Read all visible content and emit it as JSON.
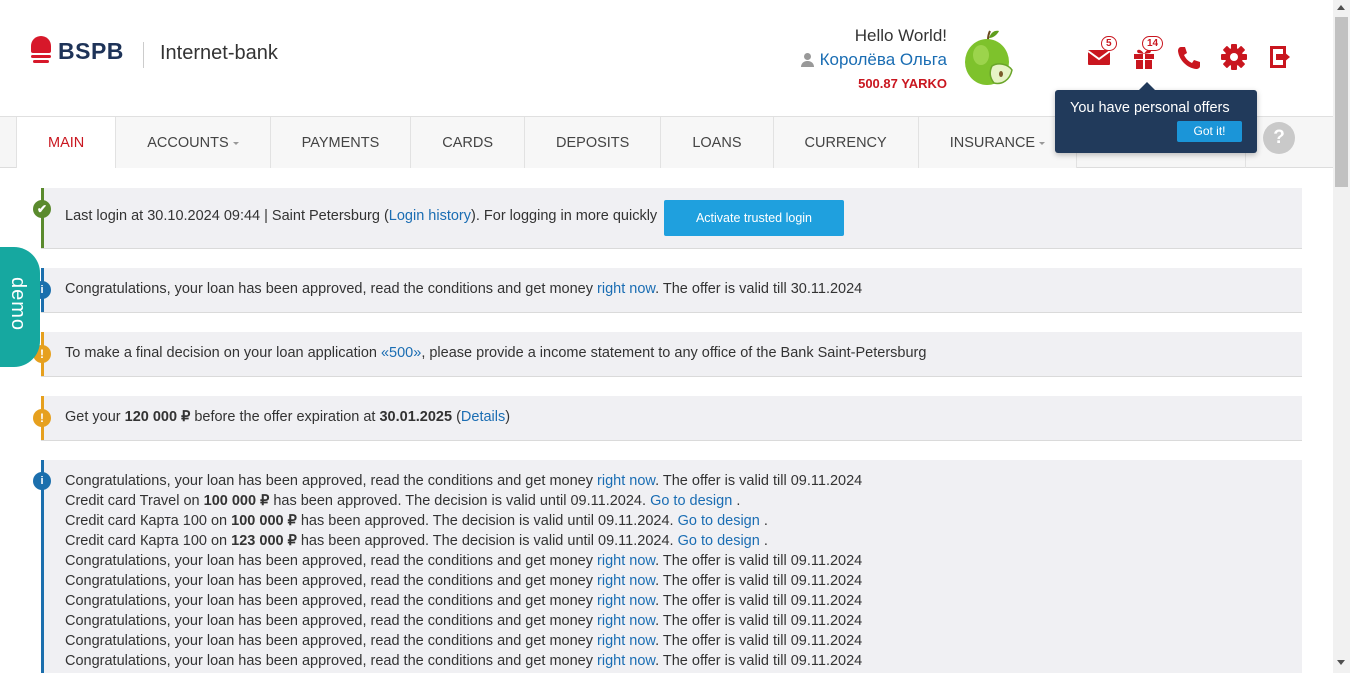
{
  "brand": {
    "logo_text": "BSPB",
    "bank_name": "Internet-bank"
  },
  "user": {
    "greeting": "Hello World!",
    "name": "Королёва Ольга",
    "bonus": "500.87 YARKO"
  },
  "header_icons": [
    {
      "icon": "mail-icon",
      "badge": "5"
    },
    {
      "icon": "gift-icon",
      "badge": "14"
    },
    {
      "icon": "phone-icon"
    },
    {
      "icon": "settings-icon"
    },
    {
      "icon": "logout-icon"
    }
  ],
  "nav": {
    "items": [
      {
        "label": "MAIN",
        "active": true
      },
      {
        "label": "ACCOUNTS",
        "dropdown": true
      },
      {
        "label": "PAYMENTS"
      },
      {
        "label": "CARDS"
      },
      {
        "label": "DEPOSITS"
      },
      {
        "label": "LOANS"
      },
      {
        "label": "CURRENCY"
      },
      {
        "label": "INSURANCE",
        "dropdown": true
      }
    ],
    "help": "?"
  },
  "tooltip": {
    "text": "You have personal offers",
    "button": "Got it!"
  },
  "demo_tab": "demo",
  "notices": {
    "login": {
      "prefix": "Last login at 30.10.2024 09:44 | Saint Petersburg (",
      "link": "Login history",
      "suffix": "). For logging in more quickly",
      "button": "Activate trusted login"
    },
    "loan_approved": {
      "prefix": "Congratulations, your loan has been approved, read the conditions and get money ",
      "link": "right now",
      "suffix": ". The offer is valid till 30.11.2024"
    },
    "income_statement": {
      "prefix": "To make a final decision on your loan application ",
      "link": "«500»",
      "suffix": ", please provide a income statement to any office of the Bank Saint-Petersburg"
    },
    "offer": {
      "prefix": "Get your ",
      "amount": "120 000 ₽",
      "middle": " before the offer expiration at ",
      "date": "30.01.2025",
      "open": " (",
      "link": "Details",
      "close": ")"
    },
    "list": [
      {
        "type": "loan",
        "prefix": "Congratulations, your loan has been approved, read the conditions and get money ",
        "link": "right now",
        "suffix": ". The offer is valid till 09.11.2024"
      },
      {
        "type": "card",
        "prefix": "Credit card Travel on ",
        "amount": "100 000 ₽",
        "middle": " has been approved. The decision is valid until 09.11.2024. ",
        "link": "Go to design",
        "suffix": " ."
      },
      {
        "type": "card",
        "prefix": "Credit card Карта 100 on ",
        "amount": "100 000 ₽",
        "middle": " has been approved. The decision is valid until 09.11.2024. ",
        "link": "Go to design",
        "suffix": " ."
      },
      {
        "type": "card",
        "prefix": "Credit card Карта 100 on ",
        "amount": "123 000 ₽",
        "middle": " has been approved. The decision is valid until 09.11.2024. ",
        "link": "Go to design",
        "suffix": " ."
      },
      {
        "type": "loan",
        "prefix": "Congratulations, your loan has been approved, read the conditions and get money ",
        "link": "right now",
        "suffix": ". The offer is valid till 09.11.2024"
      },
      {
        "type": "loan",
        "prefix": "Congratulations, your loan has been approved, read the conditions and get money ",
        "link": "right now",
        "suffix": ". The offer is valid till 09.11.2024"
      },
      {
        "type": "loan",
        "prefix": "Congratulations, your loan has been approved, read the conditions and get money ",
        "link": "right now",
        "suffix": ". The offer is valid till 09.11.2024"
      },
      {
        "type": "loan",
        "prefix": "Congratulations, your loan has been approved, read the conditions and get money ",
        "link": "right now",
        "suffix": ". The offer is valid till 09.11.2024"
      },
      {
        "type": "loan",
        "prefix": "Congratulations, your loan has been approved, read the conditions and get money ",
        "link": "right now",
        "suffix": ". The offer is valid till 09.11.2024"
      },
      {
        "type": "loan",
        "prefix": "Congratulations, your loan has been approved, read the conditions and get money ",
        "link": "right now",
        "suffix": ". The offer is valid till 09.11.2024"
      }
    ]
  },
  "colors": {
    "brand_red": "#c9161f",
    "link_blue": "#1a6db3",
    "nav_bg": "#f6f6f6",
    "tooltip_bg": "#213a5b",
    "button_blue": "#1fa0de",
    "success_green": "#5a8a2d",
    "info_blue": "#1b6fad",
    "warning_amber": "#e6a01e",
    "demo_teal": "#16a8a0"
  }
}
